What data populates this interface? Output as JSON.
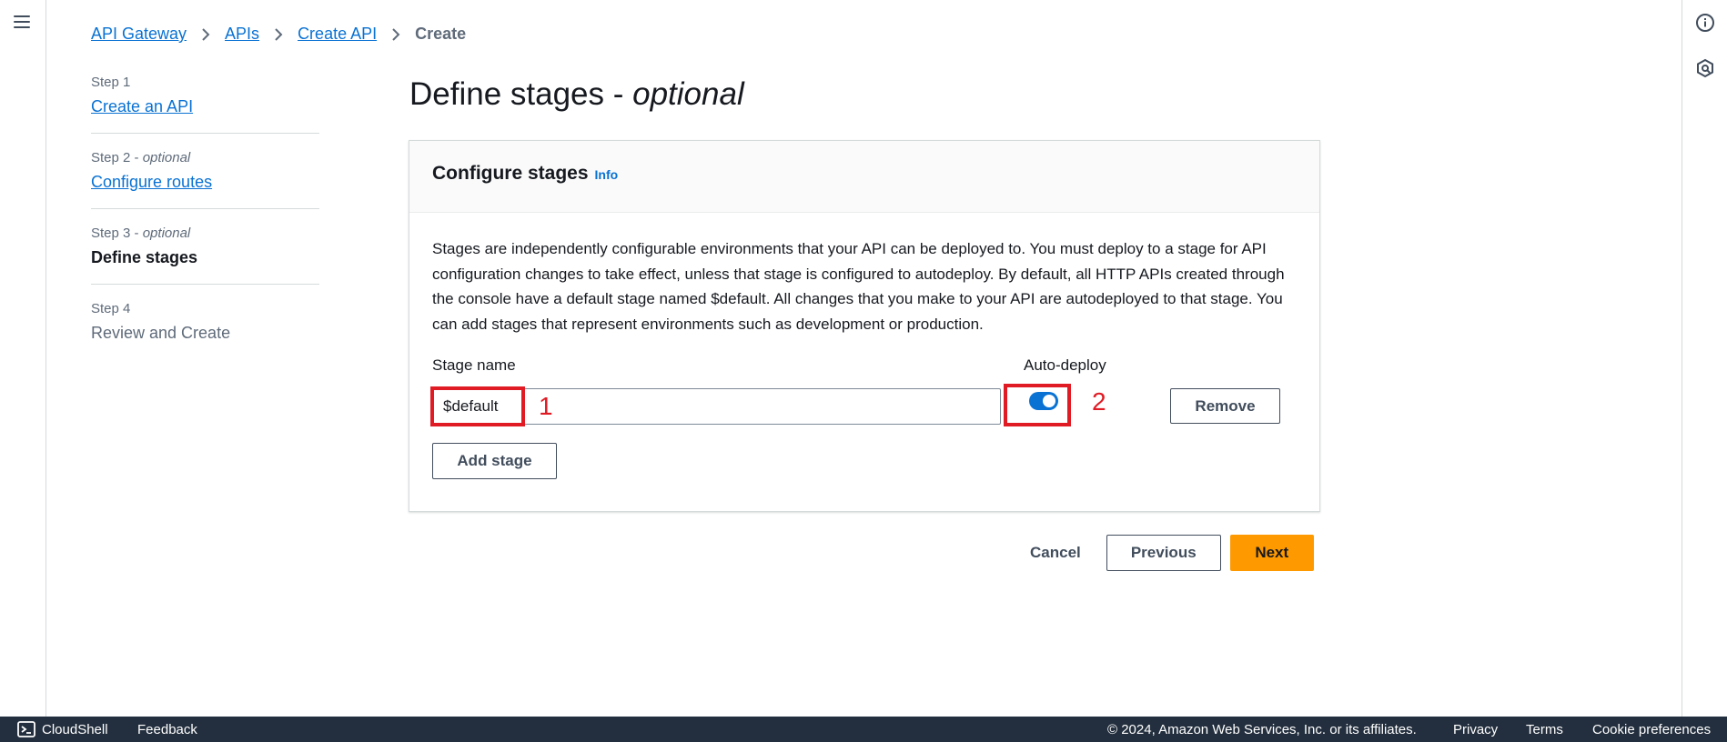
{
  "breadcrumb": {
    "items": [
      "API Gateway",
      "APIs",
      "Create API"
    ],
    "current": "Create"
  },
  "steps": [
    {
      "num": "Step 1",
      "optional": "",
      "label": "Create an API",
      "state": "link"
    },
    {
      "num": "Step 2",
      "optional": "optional",
      "label": "Configure routes",
      "state": "link"
    },
    {
      "num": "Step 3",
      "optional": "optional",
      "label": "Define stages",
      "state": "active"
    },
    {
      "num": "Step 4",
      "optional": "",
      "label": "Review and Create",
      "state": "disabled"
    }
  ],
  "page": {
    "title": "Define stages - ",
    "title_italic": "optional"
  },
  "container": {
    "title": "Configure stages",
    "info": "Info",
    "description": "Stages are independently configurable environments that your API can be deployed to. You must deploy to a stage for API configuration changes to take effect, unless that stage is configured to autodeploy. By default, all HTTP APIs created through the console have a default stage named $default. All changes that you make to your API are autodeployed to that stage. You can add stages that represent environments such as development or production.",
    "stage_name_label": "Stage name",
    "auto_deploy_label": "Auto-deploy",
    "stage_name_value": "$default",
    "auto_deploy_on": true,
    "remove_label": "Remove",
    "add_stage_label": "Add stage"
  },
  "annotations": {
    "one": "1",
    "two": "2",
    "color": "#e01b24"
  },
  "actions": {
    "cancel": "Cancel",
    "previous": "Previous",
    "next": "Next"
  },
  "footer": {
    "cloudshell": "CloudShell",
    "feedback": "Feedback",
    "copyright": "© 2024, Amazon Web Services, Inc. or its affiliates.",
    "privacy": "Privacy",
    "terms": "Terms",
    "cookies": "Cookie preferences"
  },
  "icons": {
    "menu": "hamburger-menu-icon",
    "info": "info-circle-icon",
    "notifications": "hexagon-badge-icon",
    "cloudshell": "terminal-icon",
    "separator": "chevron-right-icon"
  },
  "colors": {
    "link": "#0972d3",
    "primary": "#ff9900",
    "footer": "#232f3e",
    "toggle": "#0972d3"
  }
}
